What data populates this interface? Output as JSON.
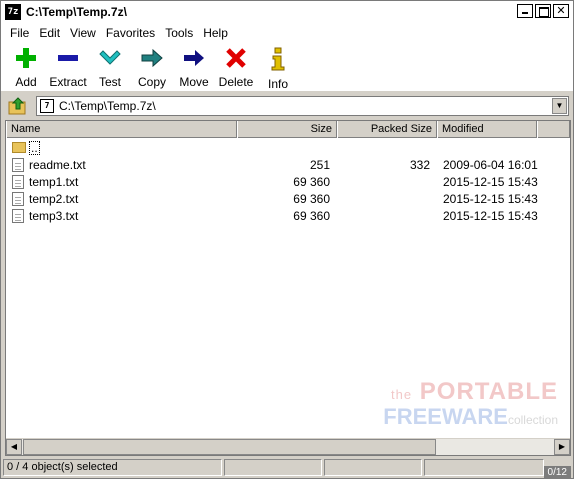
{
  "window": {
    "title": "C:\\Temp\\Temp.7z\\",
    "app_icon_text": "7z",
    "controls": {
      "minimize": "_",
      "maximize": "□",
      "close": "✕"
    }
  },
  "menu": [
    "File",
    "Edit",
    "View",
    "Favorites",
    "Tools",
    "Help"
  ],
  "toolbar": {
    "add": "Add",
    "extract": "Extract",
    "test": "Test",
    "copy": "Copy",
    "move": "Move",
    "delete": "Delete",
    "info": "Info"
  },
  "address": {
    "icon_text": "7",
    "path": "C:\\Temp\\Temp.7z\\"
  },
  "columns": {
    "name": "Name",
    "size": "Size",
    "packed": "Packed Size",
    "modified": "Modified"
  },
  "rows": [
    {
      "name": "..",
      "size": "",
      "packed": "",
      "modified": "",
      "type": "updir"
    },
    {
      "name": "readme.txt",
      "size": "251",
      "packed": "332",
      "modified": "2009-06-04 16:01",
      "type": "file"
    },
    {
      "name": "temp1.txt",
      "size": "69 360",
      "packed": "",
      "modified": "2015-12-15 15:43",
      "type": "file"
    },
    {
      "name": "temp2.txt",
      "size": "69 360",
      "packed": "",
      "modified": "2015-12-15 15:43",
      "type": "file"
    },
    {
      "name": "temp3.txt",
      "size": "69 360",
      "packed": "",
      "modified": "2015-12-15 15:43",
      "type": "file"
    }
  ],
  "watermark": {
    "the": "the",
    "portable": "PORTABLE",
    "freeware": "FREEWARE",
    "collection": "collection"
  },
  "status": {
    "selection": "0 / 4 object(s) selected",
    "counter": "0/12"
  },
  "colors": {
    "add": "#00b000",
    "extract": "#1a1aa8",
    "test": "#20c0c0",
    "copy": "#208080",
    "move": "#101080",
    "delete": "#e00000",
    "info": "#e0c000"
  }
}
